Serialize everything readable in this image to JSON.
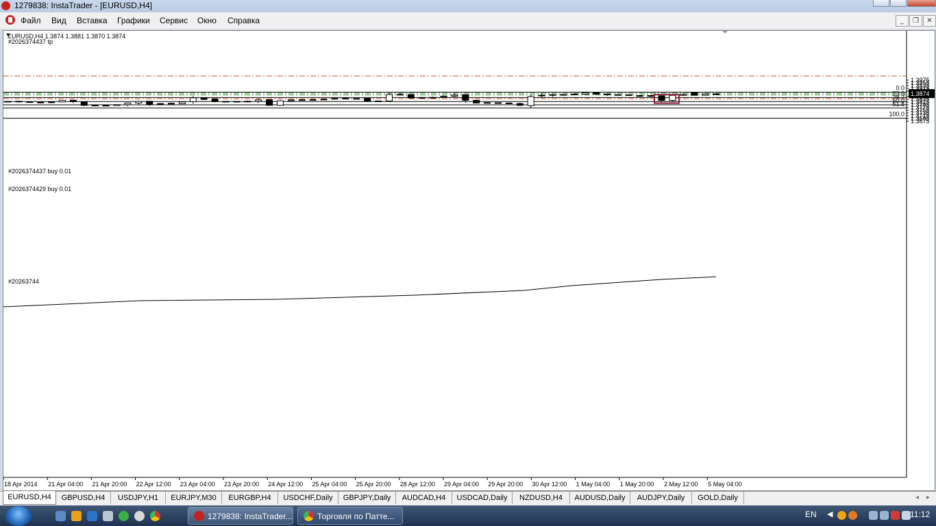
{
  "window": {
    "title": "1279838: InstaTrader - [EURUSD,H4]"
  },
  "menu": [
    "Файл",
    "Вид",
    "Вставка",
    "Графики",
    "Сервис",
    "Окно",
    "Справка"
  ],
  "chart": {
    "header": "EURUSD,H4  1.3874 1.3881 1.3870 1.3874",
    "current_price": "1.3874",
    "price_labels": [
      "1.3975",
      "1.3955",
      "1.3935",
      "1.3915",
      "1.3895",
      "1.3855",
      "1.3835",
      "1.3815",
      "1.3795",
      "1.3775",
      "1.3755",
      "1.3735",
      "1.3715",
      "1.3695",
      "1.3675"
    ],
    "time_labels": [
      "18 Apr 2014",
      "21 Apr 04:00",
      "21 Apr 20:00",
      "22 Apr 12:00",
      "23 Apr 04:00",
      "23 Apr 20:00",
      "24 Apr 12:00",
      "25 Apr 04:00",
      "25 Apr 20:00",
      "28 Apr 12:00",
      "29 Apr 04:00",
      "29 Apr 20:00",
      "30 Apr 12:00",
      "1 May 04:00",
      "1 May 20:00",
      "2 May 12:00",
      "5 May 04:00"
    ],
    "fib_levels": [
      "0.0",
      "23.6",
      "38.2",
      "50.0",
      "61.8",
      "100.0"
    ],
    "order_labels": [
      "#2026374437 tp",
      "#2026374437 buy 0.01",
      "#2026374429 buy 0.01",
      "#20263744"
    ],
    "colors": {
      "bull": "#ffffff",
      "bear": "#000000",
      "tp_line": "#c8502a",
      "order_line": "#2e8b2e",
      "highlight": "#8b1a3c"
    },
    "candles": [
      {
        "o": 1.382,
        "h": 1.3822,
        "l": 1.3816,
        "c": 1.3818
      },
      {
        "o": 1.3821,
        "h": 1.3823,
        "l": 1.3812,
        "c": 1.3817
      },
      {
        "o": 1.3817,
        "h": 1.3819,
        "l": 1.381,
        "c": 1.3812
      },
      {
        "o": 1.3814,
        "h": 1.3818,
        "l": 1.3809,
        "c": 1.3811
      },
      {
        "o": 1.3811,
        "h": 1.3818,
        "l": 1.3805,
        "c": 1.3816
      },
      {
        "o": 1.3816,
        "h": 1.3829,
        "l": 1.3814,
        "c": 1.3827
      },
      {
        "o": 1.3828,
        "h": 1.383,
        "l": 1.3808,
        "c": 1.3818
      },
      {
        "o": 1.3817,
        "h": 1.3818,
        "l": 1.3785,
        "c": 1.3791
      },
      {
        "o": 1.379,
        "h": 1.3794,
        "l": 1.3788,
        "c": 1.3792
      },
      {
        "o": 1.3791,
        "h": 1.3794,
        "l": 1.3789,
        "c": 1.379
      },
      {
        "o": 1.379,
        "h": 1.3798,
        "l": 1.3789,
        "c": 1.3796
      },
      {
        "o": 1.3796,
        "h": 1.3811,
        "l": 1.3783,
        "c": 1.3808
      },
      {
        "o": 1.3808,
        "h": 1.3825,
        "l": 1.3795,
        "c": 1.382
      },
      {
        "o": 1.3821,
        "h": 1.3822,
        "l": 1.3787,
        "c": 1.38
      },
      {
        "o": 1.38,
        "h": 1.3807,
        "l": 1.3795,
        "c": 1.3804
      },
      {
        "o": 1.3806,
        "h": 1.381,
        "l": 1.3801,
        "c": 1.3802
      },
      {
        "o": 1.3803,
        "h": 1.382,
        "l": 1.3801,
        "c": 1.3816
      },
      {
        "o": 1.3818,
        "h": 1.3858,
        "l": 1.3802,
        "c": 1.3846
      },
      {
        "o": 1.3845,
        "h": 1.3847,
        "l": 1.383,
        "c": 1.3834
      },
      {
        "o": 1.3839,
        "h": 1.3843,
        "l": 1.3812,
        "c": 1.3818
      },
      {
        "o": 1.382,
        "h": 1.3822,
        "l": 1.3813,
        "c": 1.3816
      },
      {
        "o": 1.3816,
        "h": 1.3823,
        "l": 1.3813,
        "c": 1.382
      },
      {
        "o": 1.3818,
        "h": 1.3826,
        "l": 1.3816,
        "c": 1.3821
      },
      {
        "o": 1.382,
        "h": 1.3841,
        "l": 1.3808,
        "c": 1.3831
      },
      {
        "o": 1.3832,
        "h": 1.3834,
        "l": 1.379,
        "c": 1.3791
      },
      {
        "o": 1.3791,
        "h": 1.3831,
        "l": 1.3789,
        "c": 1.3824
      },
      {
        "o": 1.3825,
        "h": 1.3834,
        "l": 1.3822,
        "c": 1.3831
      },
      {
        "o": 1.3832,
        "h": 1.3835,
        "l": 1.3827,
        "c": 1.3828
      },
      {
        "o": 1.3828,
        "h": 1.3836,
        "l": 1.3826,
        "c": 1.3833
      },
      {
        "o": 1.3833,
        "h": 1.384,
        "l": 1.3829,
        "c": 1.3836
      },
      {
        "o": 1.3836,
        "h": 1.3846,
        "l": 1.3833,
        "c": 1.3842
      },
      {
        "o": 1.3842,
        "h": 1.3848,
        "l": 1.3837,
        "c": 1.3837
      },
      {
        "o": 1.3841,
        "h": 1.3845,
        "l": 1.3833,
        "c": 1.3836
      },
      {
        "o": 1.3842,
        "h": 1.3843,
        "l": 1.3815,
        "c": 1.382
      },
      {
        "o": 1.3818,
        "h": 1.3825,
        "l": 1.3815,
        "c": 1.3823
      },
      {
        "o": 1.3823,
        "h": 1.3881,
        "l": 1.3816,
        "c": 1.387
      },
      {
        "o": 1.387,
        "h": 1.388,
        "l": 1.3865,
        "c": 1.3871
      },
      {
        "o": 1.387,
        "h": 1.3873,
        "l": 1.384,
        "c": 1.3845
      },
      {
        "o": 1.3845,
        "h": 1.3851,
        "l": 1.384,
        "c": 1.3848
      },
      {
        "o": 1.3847,
        "h": 1.3854,
        "l": 1.3844,
        "c": 1.3849
      },
      {
        "o": 1.3852,
        "h": 1.3862,
        "l": 1.3849,
        "c": 1.3858
      },
      {
        "o": 1.3858,
        "h": 1.388,
        "l": 1.3851,
        "c": 1.3866
      },
      {
        "o": 1.3869,
        "h": 1.3872,
        "l": 1.3811,
        "c": 1.3828
      },
      {
        "o": 1.3828,
        "h": 1.383,
        "l": 1.3803,
        "c": 1.3808
      },
      {
        "o": 1.3808,
        "h": 1.3812,
        "l": 1.3806,
        "c": 1.3811
      },
      {
        "o": 1.381,
        "h": 1.3812,
        "l": 1.3806,
        "c": 1.3807
      },
      {
        "o": 1.3808,
        "h": 1.381,
        "l": 1.3803,
        "c": 1.3805
      },
      {
        "o": 1.3804,
        "h": 1.3811,
        "l": 1.3786,
        "c": 1.3791
      },
      {
        "o": 1.3789,
        "h": 1.3865,
        "l": 1.3772,
        "c": 1.3855
      },
      {
        "o": 1.386,
        "h": 1.3877,
        "l": 1.385,
        "c": 1.3865
      },
      {
        "o": 1.3865,
        "h": 1.3874,
        "l": 1.3853,
        "c": 1.3869
      },
      {
        "o": 1.3866,
        "h": 1.3872,
        "l": 1.3862,
        "c": 1.387
      },
      {
        "o": 1.3869,
        "h": 1.3876,
        "l": 1.3865,
        "c": 1.3873
      },
      {
        "o": 1.3872,
        "h": 1.3887,
        "l": 1.387,
        "c": 1.3883
      },
      {
        "o": 1.3885,
        "h": 1.3885,
        "l": 1.3869,
        "c": 1.3873
      },
      {
        "o": 1.3873,
        "h": 1.3874,
        "l": 1.386,
        "c": 1.3868
      },
      {
        "o": 1.3869,
        "h": 1.3871,
        "l": 1.3864,
        "c": 1.3869
      },
      {
        "o": 1.3868,
        "h": 1.3869,
        "l": 1.3862,
        "c": 1.3863
      },
      {
        "o": 1.3861,
        "h": 1.3866,
        "l": 1.3856,
        "c": 1.3862
      },
      {
        "o": 1.3862,
        "h": 1.3866,
        "l": 1.3851,
        "c": 1.386
      },
      {
        "o": 1.386,
        "h": 1.3864,
        "l": 1.3816,
        "c": 1.3827
      },
      {
        "o": 1.3827,
        "h": 1.3865,
        "l": 1.3815,
        "c": 1.3864
      },
      {
        "o": 1.3864,
        "h": 1.3878,
        "l": 1.3863,
        "c": 1.387
      },
      {
        "o": 1.3884,
        "h": 1.3886,
        "l": 1.3863,
        "c": 1.3864
      },
      {
        "o": 1.3864,
        "h": 1.3878,
        "l": 1.3863,
        "c": 1.3874
      },
      {
        "o": 1.3874,
        "h": 1.3881,
        "l": 1.387,
        "c": 1.3874
      }
    ]
  },
  "tabs": [
    "EURUSD,H4",
    "GBPUSD,H4",
    "USDJPY,H1",
    "EURJPY,M30",
    "EURGBP,H4",
    "USDCHF,Daily",
    "GBPJPY,Daily",
    "AUDCAD,H4",
    "USDCAD,Daily",
    "NZDUSD,H4",
    "AUDUSD,Daily",
    "AUDJPY,Daily",
    "GOLD,Daily"
  ],
  "taskbar": {
    "buttons": [
      "1279838: InstaTrader...",
      "Торговля по Патте..."
    ],
    "language": "EN",
    "clock": "11:12"
  }
}
